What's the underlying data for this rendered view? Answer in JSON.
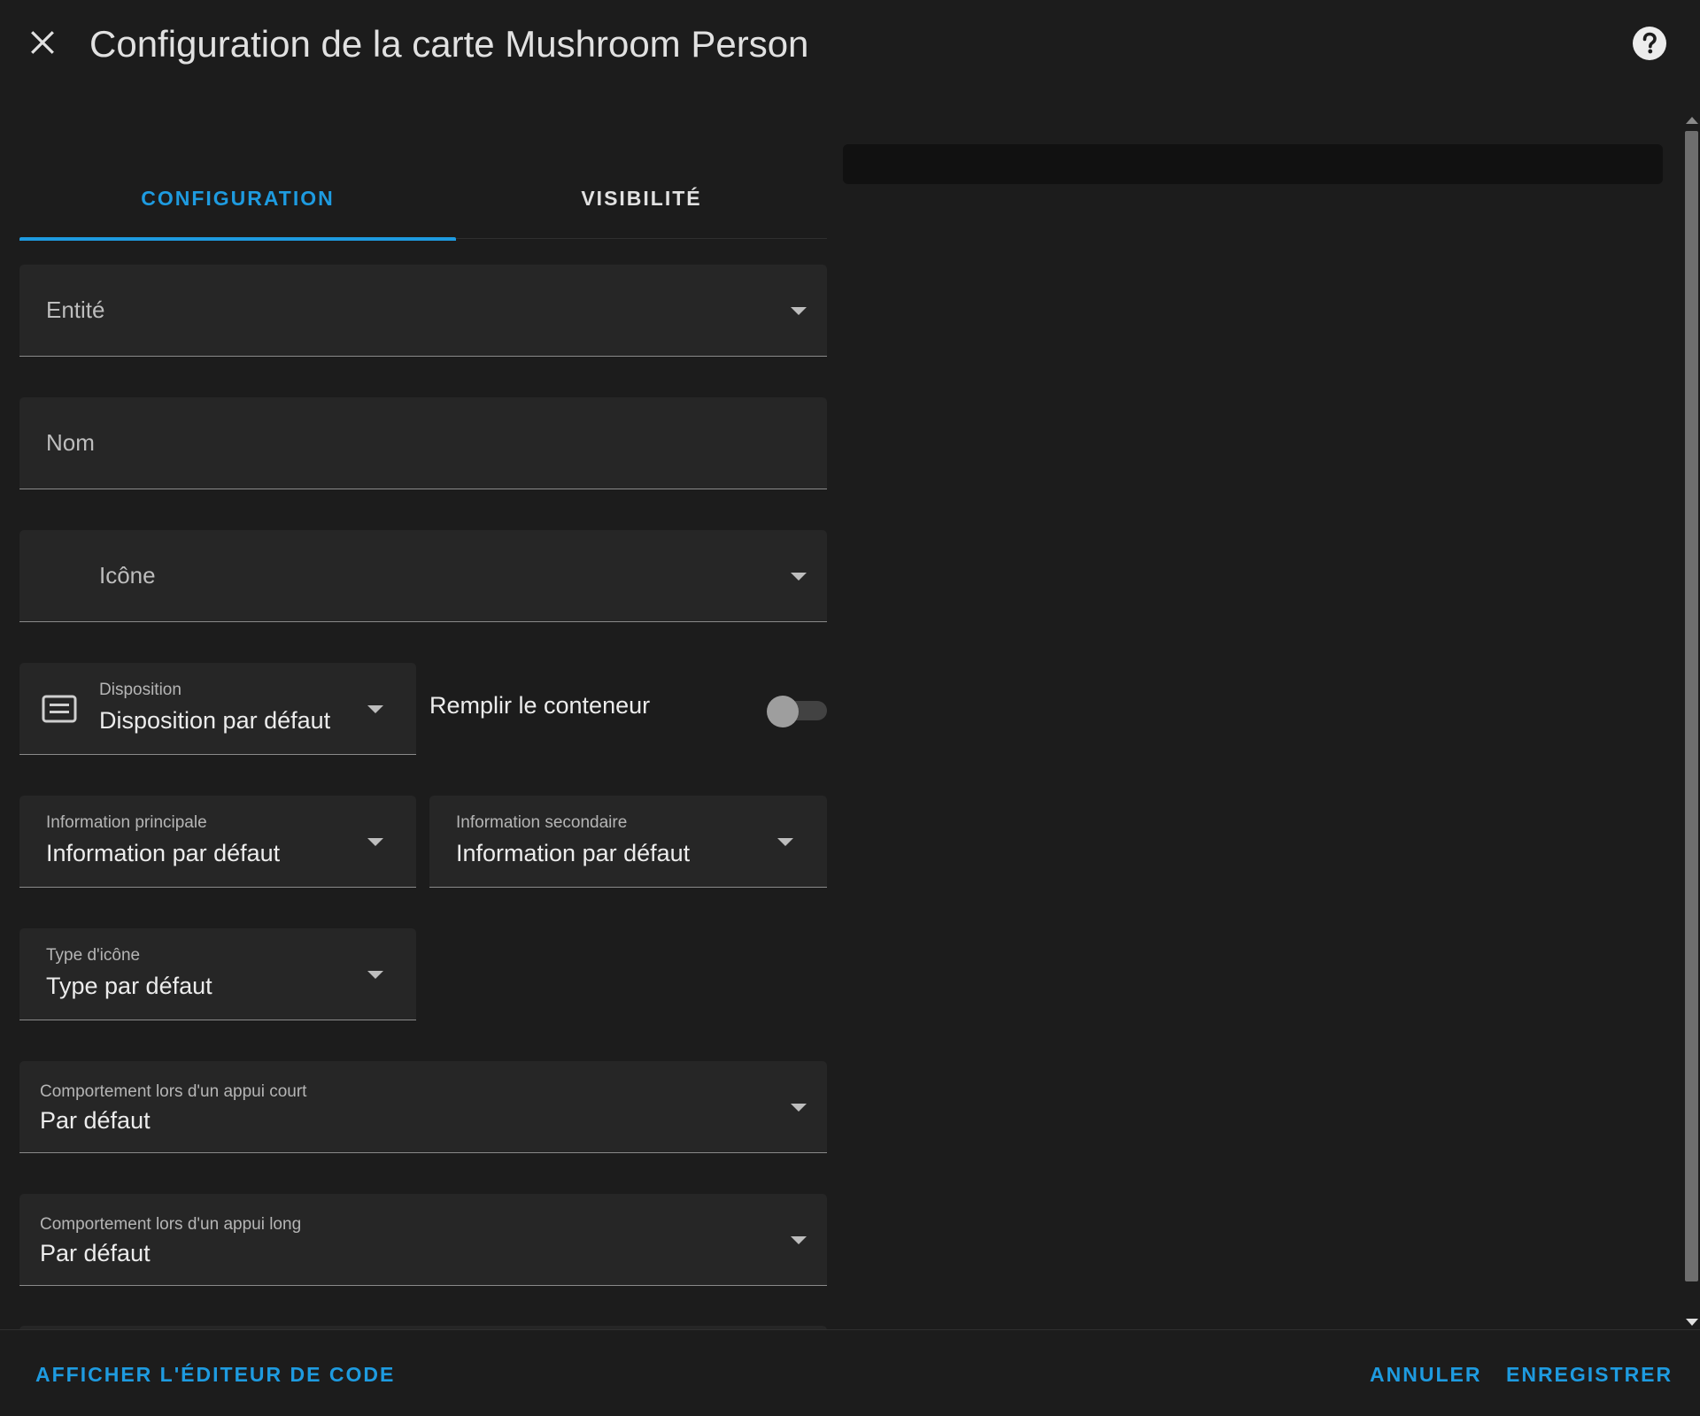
{
  "header": {
    "title": "Configuration de la carte Mushroom Person",
    "close_icon": "close-icon",
    "help_icon": "help-circle-icon"
  },
  "tabs": [
    {
      "label": "CONFIGURATION",
      "active": true
    },
    {
      "label": "VISIBILITÉ",
      "active": false
    }
  ],
  "form": {
    "entity": {
      "placeholder": "Entité"
    },
    "name": {
      "placeholder": "Nom"
    },
    "icon": {
      "placeholder": "Icône"
    },
    "layout": {
      "label": "Disposition",
      "value": "Disposition par défaut",
      "icon": "card-layout-icon"
    },
    "fill_container": {
      "label": "Remplir le conteneur",
      "on": false
    },
    "primary_info": {
      "label": "Information principale",
      "value": "Information par défaut"
    },
    "secondary_info": {
      "label": "Information secondaire",
      "value": "Information par défaut"
    },
    "icon_type": {
      "label": "Type d'icône",
      "value": "Type par défaut"
    },
    "tap_action": {
      "label": "Comportement lors d'un appui court",
      "value": "Par défaut"
    },
    "hold_action": {
      "label": "Comportement lors d'un appui long",
      "value": "Par défaut"
    }
  },
  "footer": {
    "code_editor": "AFFICHER L'ÉDITEUR DE CODE",
    "cancel": "ANNULER",
    "save": "ENREGISTRER"
  },
  "colors": {
    "accent": "#1e9be0",
    "background": "#1c1c1c",
    "field": "#262626"
  }
}
